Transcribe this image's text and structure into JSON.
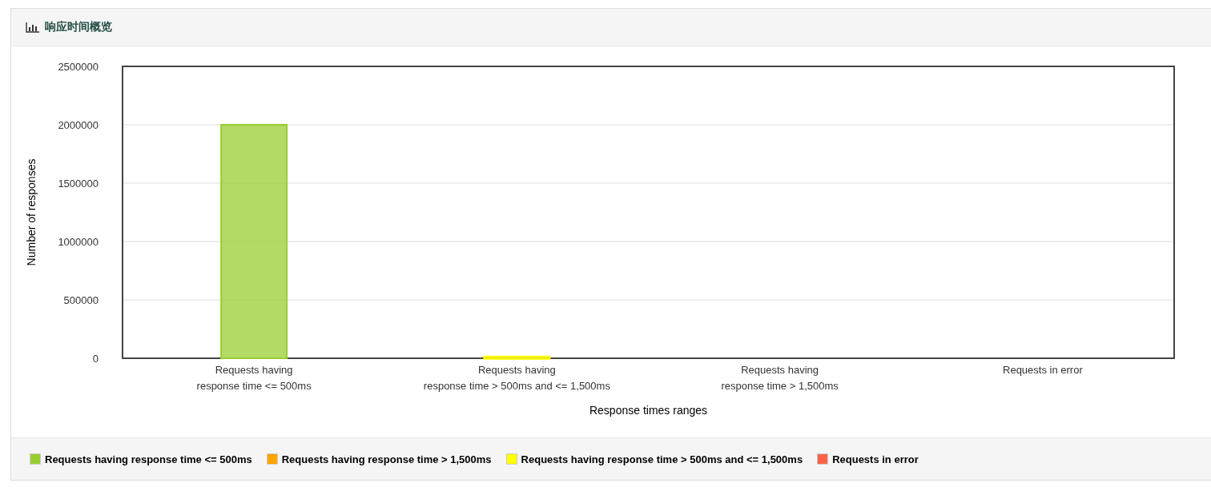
{
  "panel": {
    "title": "响应时间概览"
  },
  "chart_data": {
    "type": "bar",
    "xlabel": "Response times ranges",
    "ylabel": "Number of responses",
    "stacked": true,
    "grid": true,
    "categories": [
      "Requests having\nresponse time <= 500ms",
      "Requests having\nresponse time > 500ms and <= 1,500ms",
      "Requests having\nresponse time > 1,500ms",
      "Requests in error"
    ],
    "ylim": [
      0,
      2500000
    ],
    "yticks": [
      0,
      500000,
      1000000,
      1500000,
      2000000,
      2500000
    ],
    "series": [
      {
        "name": "Requests having response time <= 500ms",
        "color": "#9acd32",
        "values": [
          2000000,
          0,
          0,
          0
        ]
      },
      {
        "name": "Requests having response time > 1,500ms",
        "color": "#ffa500",
        "values": [
          0,
          0,
          0,
          0
        ]
      },
      {
        "name": "Requests having response time > 500ms and <= 1,500ms",
        "color": "#ffff00",
        "values": [
          0,
          15000,
          0,
          0
        ]
      },
      {
        "name": "Requests in error",
        "color": "#ff6347",
        "values": [
          0,
          0,
          0,
          0
        ]
      }
    ]
  }
}
